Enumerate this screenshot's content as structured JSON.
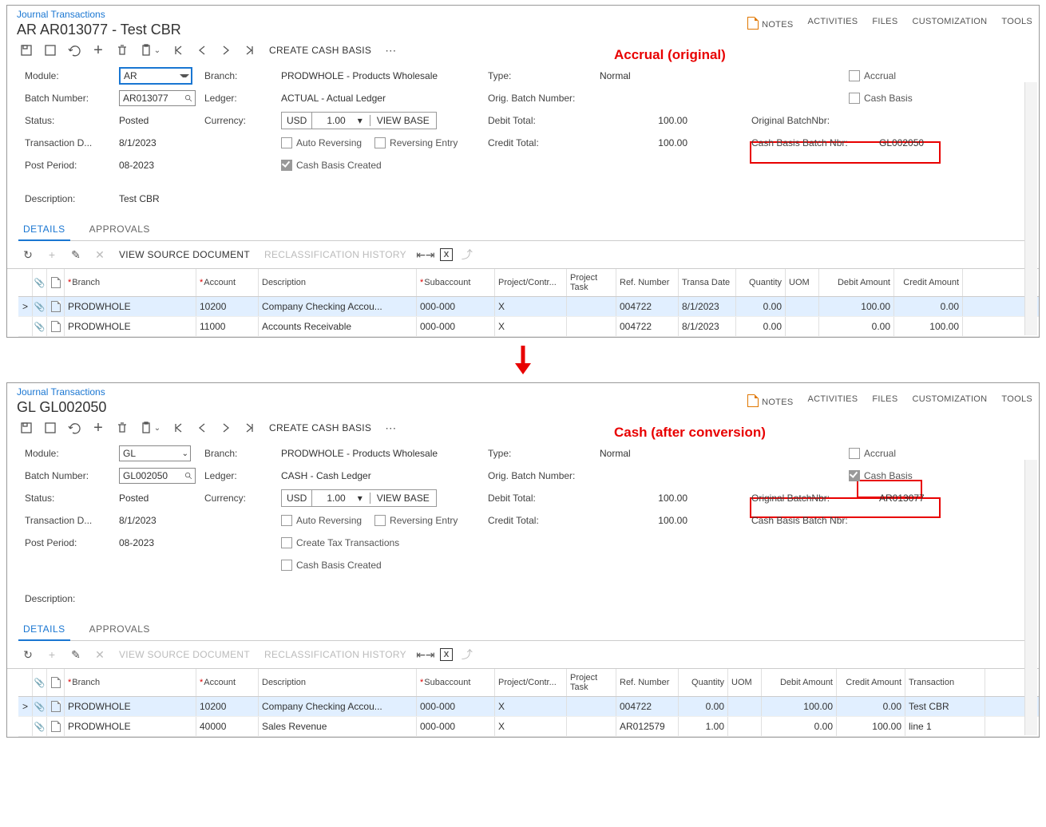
{
  "header": {
    "crumb": "Journal Transactions",
    "menu": {
      "notes": "NOTES",
      "activities": "ACTIVITIES",
      "files": "FILES",
      "customization": "CUSTOMIZATION",
      "tools": "TOOLS"
    },
    "cash_basis_btn": "CREATE CASH BASIS",
    "view_base": "VIEW BASE",
    "view_source": "VIEW SOURCE DOCUMENT",
    "reclass": "RECLASSIFICATION HISTORY"
  },
  "tabs": {
    "details": "DETAILS",
    "approvals": "APPROVALS"
  },
  "labels": {
    "module": "Module:",
    "batchnbr": "Batch Number:",
    "status": "Status:",
    "trdate": "Transaction D...",
    "postperiod": "Post Period:",
    "description": "Description:",
    "branch": "Branch:",
    "ledger": "Ledger:",
    "currency": "Currency:",
    "autorev": "Auto Reversing",
    "reventry": "Reversing Entry",
    "cbcreated": "Cash Basis Created",
    "createtax": "Create Tax Transactions",
    "type": "Type:",
    "origbn": "Orig. Batch Number:",
    "debittot": "Debit Total:",
    "credittot": "Credit Total:",
    "accrual": "Accrual",
    "cashbasis": "Cash Basis",
    "origbn2": "Original BatchNbr:",
    "cbbn": "Cash Basis Batch Nbr:"
  },
  "cols": {
    "branch": "Branch",
    "account": "Account",
    "description": "Description",
    "subaccount": "Subaccount",
    "project": "Project/Contr...",
    "task": "Project Task",
    "ref": "Ref. Number",
    "trdate": "Transa Date",
    "qty": "Quantity",
    "uom": "UOM",
    "debit": "Debit Amount",
    "credit": "Credit Amount",
    "trdesc": "Transaction"
  },
  "annot": {
    "top": "Accrual (original)",
    "bottom": "Cash (after conversion)"
  },
  "screen1": {
    "title": "AR AR013077 - Test CBR",
    "module": "AR",
    "batchnbr": "AR013077",
    "status": "Posted",
    "trdate": "8/1/2023",
    "postperiod": "08-2023",
    "description": "Test CBR",
    "branch": "PRODWHOLE - Products Wholesale",
    "ledger": "ACTUAL - Actual Ledger",
    "cur": "USD",
    "rate": "1.00",
    "cb_created_checked": true,
    "type": "Normal",
    "debit": "100.00",
    "credit": "100.00",
    "accrual_checked": false,
    "cashbasis_checked": false,
    "origbn2": "",
    "cbbn": "GL002050",
    "rows": [
      {
        "branch": "PRODWHOLE",
        "acct": "10200",
        "desc": "Company Checking Accou...",
        "sub": "000-000",
        "proj": "X",
        "task": "",
        "ref": "004722",
        "trdate": "8/1/2023",
        "qty": "0.00",
        "uom": "",
        "debit": "100.00",
        "credit": "0.00"
      },
      {
        "branch": "PRODWHOLE",
        "acct": "11000",
        "desc": "Accounts Receivable",
        "sub": "000-000",
        "proj": "X",
        "task": "",
        "ref": "004722",
        "trdate": "8/1/2023",
        "qty": "0.00",
        "uom": "",
        "debit": "0.00",
        "credit": "100.00"
      }
    ]
  },
  "screen2": {
    "title": "GL GL002050",
    "module": "GL",
    "batchnbr": "GL002050",
    "status": "Posted",
    "trdate": "8/1/2023",
    "postperiod": "08-2023",
    "description": "",
    "branch": "PRODWHOLE - Products Wholesale",
    "ledger": "CASH - Cash Ledger",
    "cur": "USD",
    "rate": "1.00",
    "cb_created_checked": false,
    "type": "Normal",
    "debit": "100.00",
    "credit": "100.00",
    "accrual_checked": false,
    "cashbasis_checked": true,
    "origbn2": "AR013077",
    "cbbn": "",
    "rows": [
      {
        "branch": "PRODWHOLE",
        "acct": "10200",
        "desc": "Company Checking Accou...",
        "sub": "000-000",
        "proj": "X",
        "task": "",
        "ref": "004722",
        "qty": "0.00",
        "uom": "",
        "debit": "100.00",
        "credit": "0.00",
        "trdesc": "Test CBR"
      },
      {
        "branch": "PRODWHOLE",
        "acct": "40000",
        "desc": "Sales Revenue",
        "sub": "000-000",
        "proj": "X",
        "task": "",
        "ref": "AR012579",
        "qty": "1.00",
        "uom": "",
        "debit": "0.00",
        "credit": "100.00",
        "trdesc": "line 1"
      }
    ]
  }
}
